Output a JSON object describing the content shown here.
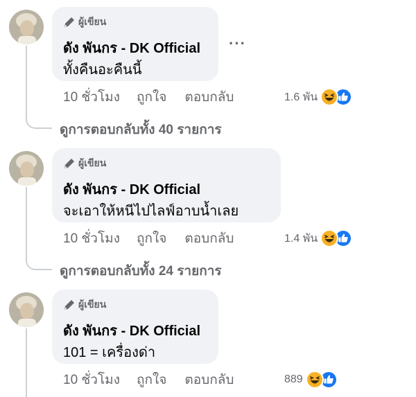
{
  "comments": [
    {
      "badge": "ผู้เขียน",
      "author": "ดัง พันกร - DK Official",
      "text": "ทั้งคืนอะคืนนี้",
      "more": "···",
      "time": "10 ชั่วโมง",
      "like": "ถูกใจ",
      "reply": "ตอบกลับ",
      "reaction_count": "1.6 พัน",
      "view_replies": "ดูการตอบกลับทั้ง 40 รายการ"
    },
    {
      "badge": "ผู้เขียน",
      "author": "ดัง พันกร - DK Official",
      "text": "จะเอาให้หนีไปไลฟ์อาบน้ำเลย",
      "time": "10 ชั่วโมง",
      "like": "ถูกใจ",
      "reply": "ตอบกลับ",
      "reaction_count": "1.4 พัน",
      "view_replies": "ดูการตอบกลับทั้ง 24 รายการ"
    },
    {
      "badge": "ผู้เขียน",
      "author": "ดัง พันกร - DK Official",
      "text": "101 = เครื่องด่า",
      "time": "10 ชั่วโมง",
      "like": "ถูกใจ",
      "reply": "ตอบกลับ",
      "reaction_count": "889"
    }
  ],
  "icons": {
    "badge": "pen-icon",
    "reaction_1": "haha-emoji-icon",
    "reaction_2": "like-thumb-icon"
  },
  "colors": {
    "bubble": "#f0f2f5",
    "secondary_text": "#65676b",
    "like_blue": "#1877f2",
    "haha_yellow": "#f7b125",
    "thread_line": "#ccd0d5"
  }
}
